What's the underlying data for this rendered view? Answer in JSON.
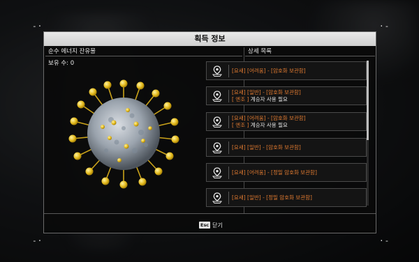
{
  "dialog": {
    "title": "획득 정보",
    "left_header": "순수 에너지 잔유물",
    "right_header": "상세 목록",
    "owned_count": "보유 수: 0",
    "close_key": "Esc",
    "close_label": "닫기"
  },
  "items": [
    {
      "line1": "[요새] [어려움] - [암호화 보관함]",
      "tag": "",
      "line2": ""
    },
    {
      "line1": "[요새] [일반] - [암호화 보관함]",
      "tag": "[ 엔조 ]",
      "line2": " 계승자 사용 필요"
    },
    {
      "line1": "[요새] [어려움] - [암호화 보관함]",
      "tag": "[ 엔조 ]",
      "line2": " 계승자 사용 필요"
    },
    {
      "line1": "[요새] [일반] - [암호화 보관함]",
      "tag": "",
      "line2": ""
    },
    {
      "line1": "[요새] [어려움] - [정밀 암호화 보관함]",
      "tag": "",
      "line2": ""
    },
    {
      "line1": "[요새] [일반] - [정밀 암호화 보관함]",
      "tag": "",
      "line2": ""
    }
  ],
  "colors": {
    "accent_orange": "#e07a30",
    "text": "#e6e6e6",
    "title_bar": "#dcdcdc"
  },
  "icons": {
    "list_item": "location-pin-icon",
    "item_preview": "virus-particle-icon"
  }
}
